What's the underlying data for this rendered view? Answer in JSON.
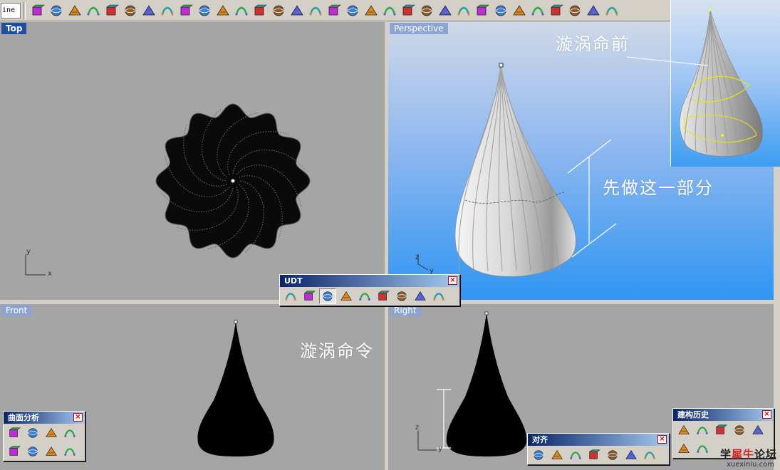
{
  "toolbar": {
    "command_stub": "ine",
    "icons": [
      "box-icon",
      "sphere-icon",
      "cylinder-icon",
      "curve-icon",
      "fillet-icon",
      "axes-icon",
      "extrude-icon",
      "grid-points-icon",
      "rebuild-icon",
      "polygon-icon",
      "split-icon",
      "surface-icon",
      "arch-icon",
      "flip-icon",
      "panel-icon",
      "book-icon",
      "tower-icon",
      "check-icon",
      "network-icon",
      "boolean-icon",
      "grid-icon",
      "cage-icon",
      "morph-icon",
      "bend-icon",
      "twist-icon",
      "star-icon",
      "mesh-icon",
      "loft-icon",
      "blend-icon",
      "scissors-icon",
      "shade-icon",
      "snap-icon"
    ]
  },
  "viewports": {
    "top": {
      "label": "Top",
      "axis_y": "y",
      "axis_x": "x"
    },
    "perspective": {
      "label": "Perspective",
      "axis_z": "z",
      "axis_y": "y"
    },
    "front": {
      "label": "Front"
    },
    "right": {
      "label": "Right",
      "axis_z": "z",
      "axis_y": "y"
    }
  },
  "palettes": {
    "udt": {
      "title": "UDT",
      "close": "×",
      "icons": [
        "flow-icon",
        "twisty-icon",
        "cage-edit-icon",
        "splop-icon",
        "stretch-icon",
        "bend-icon",
        "taper-icon",
        "shear-icon",
        "maelstrom-icon"
      ]
    },
    "surface_analysis": {
      "title": "曲面分析",
      "close": "×",
      "icons": [
        "zebra-icon",
        "curvature-icon",
        "environment-map-icon",
        "draft-angle-icon",
        "edge-analysis-icon",
        "point-deviation-icon",
        "thickness-icon",
        "emap-icon"
      ]
    },
    "history": {
      "title": "建构历史",
      "close": "×",
      "icons": [
        "record-history-icon",
        "update-history-icon",
        "history-lock-icon",
        "history-purge-icon",
        "history-unlock-icon",
        "select-children-icon",
        "select-parents-icon"
      ]
    },
    "align": {
      "title": "对齐",
      "close": "×",
      "icons": [
        "align-bottom-icon",
        "align-top-icon",
        "align-left-icon",
        "align-right-icon",
        "align-center-h-icon",
        "align-center-v-icon",
        "align-center-icon"
      ]
    }
  },
  "annotations": {
    "before_maelstrom": "漩涡命前",
    "do_this_part": "先做这一部分",
    "maelstrom_command": "漩涡命令"
  },
  "watermark": {
    "logo_a": "学",
    "logo_b": "犀牛",
    "logo_c": "论坛",
    "url": "xuexiniu.com"
  },
  "colors": {
    "active_label": "#1f4ea0",
    "viewport_gray": "#a5a5a5",
    "title_bar": "#0a246a"
  }
}
